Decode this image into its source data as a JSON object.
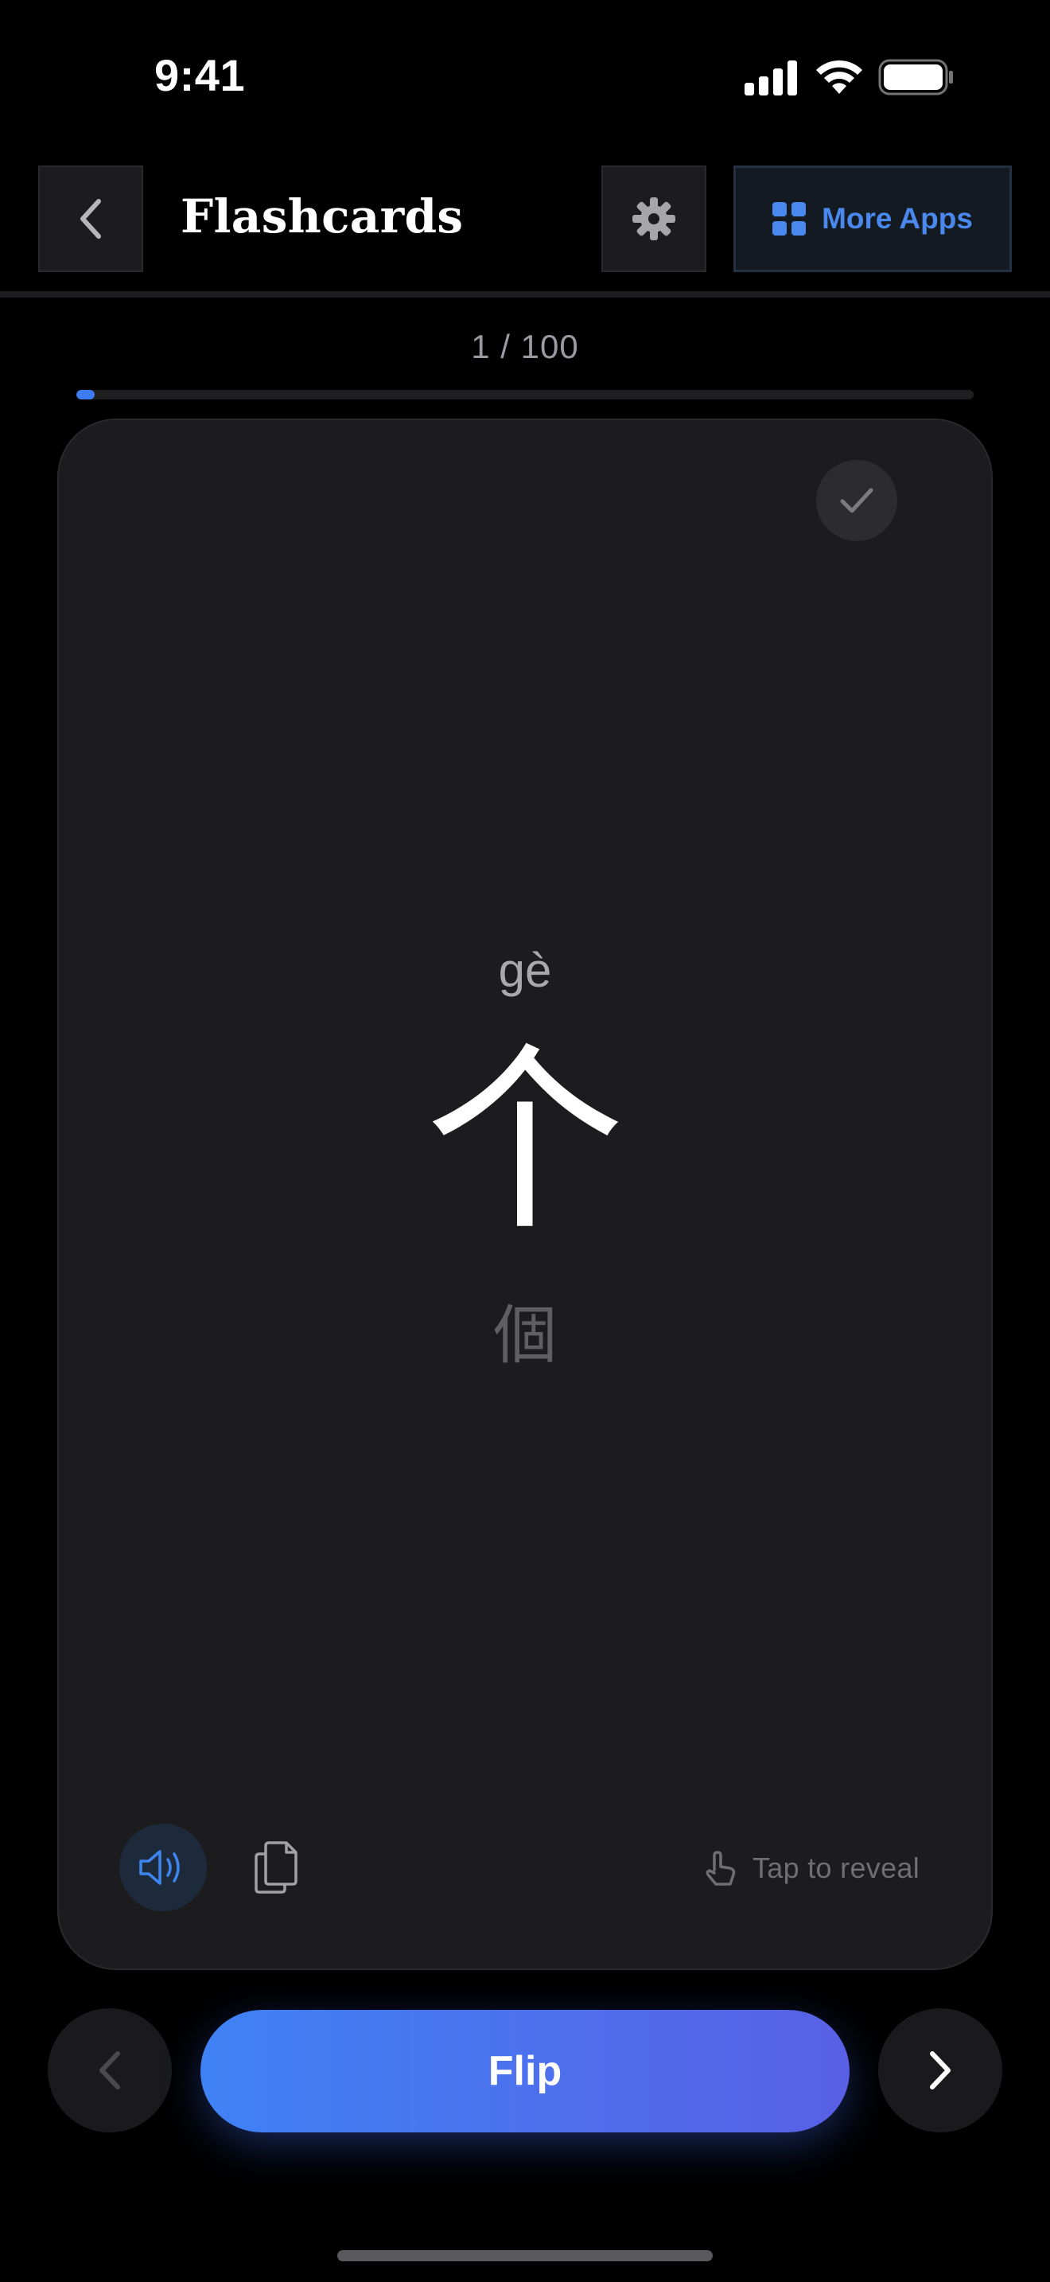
{
  "status_bar": {
    "time": "9:41"
  },
  "header": {
    "title": "Flashcards",
    "more_apps_label": "More Apps"
  },
  "progress": {
    "label": "1 / 100",
    "current": 1,
    "total": 100
  },
  "card": {
    "pinyin": "gè",
    "simplified": "个",
    "traditional": "個",
    "tap_hint": "Tap to reveal"
  },
  "controls": {
    "flip_label": "Flip"
  },
  "colors": {
    "accent": "#4a88ee",
    "flip_gradient_start": "#3f82f5",
    "flip_gradient_end": "#5960e6",
    "card_background": "#1c1c1e",
    "background": "#000000"
  },
  "icons": {
    "back": "chevron-left-icon",
    "settings": "gear-icon",
    "more_apps": "grid-icon",
    "known": "checkmark-icon",
    "audio": "speaker-icon",
    "copy": "copy-icon",
    "tap": "tap-hand-icon",
    "prev": "chevron-left-icon",
    "next": "chevron-right-icon"
  }
}
